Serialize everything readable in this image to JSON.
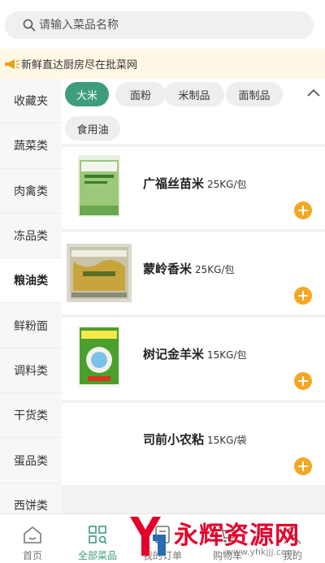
{
  "search": {
    "placeholder": "请输入菜品名称",
    "value": ""
  },
  "notice": {
    "text": "新鲜直达厨房尽在批菜网"
  },
  "sidebar": {
    "active_index": 4,
    "items": [
      {
        "label": "收藏夹"
      },
      {
        "label": "蔬菜类"
      },
      {
        "label": "肉禽类"
      },
      {
        "label": "冻品类"
      },
      {
        "label": "粮油类"
      },
      {
        "label": "鲜粉面"
      },
      {
        "label": "调料类"
      },
      {
        "label": "干货类"
      },
      {
        "label": "蛋品类"
      },
      {
        "label": "西饼类"
      }
    ]
  },
  "filters": {
    "active_index": 0,
    "chips": [
      {
        "label": "大米"
      },
      {
        "label": "面粉"
      },
      {
        "label": "米制品"
      },
      {
        "label": "面制品"
      },
      {
        "label": "食用油"
      }
    ]
  },
  "products": [
    {
      "name": "广福丝苗米",
      "spec": "25KG/包",
      "has_image": true
    },
    {
      "name": "蒙岭香米",
      "spec": "25KG/包",
      "has_image": true
    },
    {
      "name": "树记金羊米",
      "spec": "15KG/包",
      "has_image": true
    },
    {
      "name": "司前小农粘",
      "spec": "15KG/袋",
      "has_image": false
    }
  ],
  "bottom_nav": {
    "active_index": 1,
    "items": [
      {
        "label": "首页",
        "icon": "home-icon"
      },
      {
        "label": "全部菜品",
        "icon": "grid-icon"
      },
      {
        "label": "我的订单",
        "icon": "orders-icon"
      },
      {
        "label": "购物车",
        "icon": "cart-icon"
      },
      {
        "label": "我的",
        "icon": "user-icon"
      }
    ]
  },
  "watermark": {
    "title": "永辉资源网",
    "url": "www.yhkjjj.com"
  },
  "colors": {
    "accent": "#3f9d7f",
    "add_button": "#f5a623",
    "notice_bg": "#fff8e6"
  }
}
